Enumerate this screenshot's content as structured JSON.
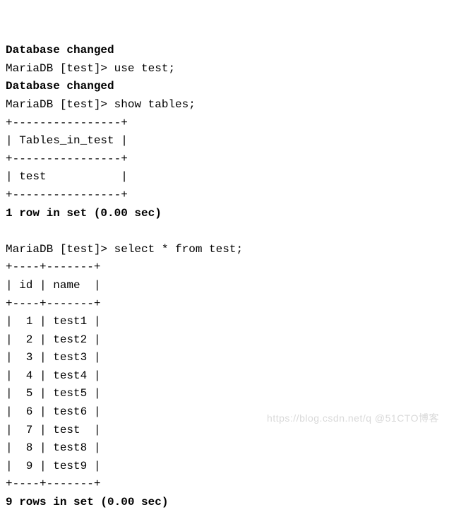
{
  "lines": {
    "db_changed1": "Database changed",
    "prompt1": "MariaDB [test]> use test;",
    "db_changed2": "Database changed",
    "prompt2": "MariaDB [test]> show tables;",
    "border1": "+----------------+",
    "header1": "| Tables_in_test |",
    "border2": "+----------------+",
    "row_tables": "| test           |",
    "border3": "+----------------+",
    "result1": "1 row in set (0.00 sec)",
    "blank1": "",
    "prompt3": "MariaDB [test]> select * from test;",
    "border4": "+----+-------+",
    "header2": "| id | name  |",
    "border5": "+----+-------+",
    "r1": "|  1 | test1 |",
    "r2": "|  2 | test2 |",
    "r3": "|  3 | test3 |",
    "r4": "|  4 | test4 |",
    "r5": "|  5 | test5 |",
    "r6": "|  6 | test6 |",
    "r7": "|  7 | test  |",
    "r8": "|  8 | test8 |",
    "r9": "|  9 | test9 |",
    "border6": "+----+-------+",
    "result2": "9 rows in set (0.00 sec)"
  },
  "watermark": "https://blog.csdn.net/q    @51CTO博客"
}
